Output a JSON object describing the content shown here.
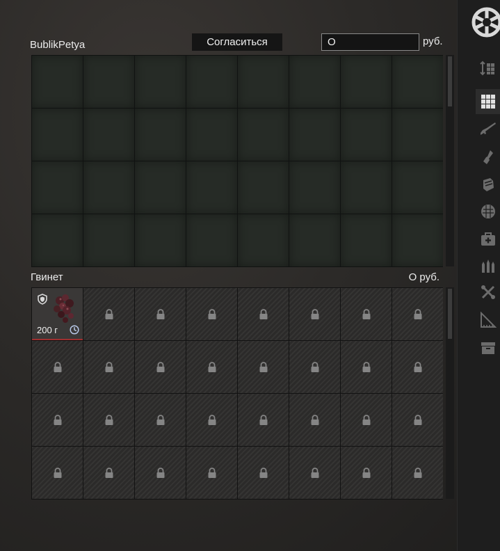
{
  "player": {
    "name": "BublikPetya"
  },
  "trade": {
    "accept_label": "Согласиться",
    "price_value": "О",
    "currency": "руб."
  },
  "trader": {
    "name": "Гвинет",
    "total": "О руб.",
    "item": {
      "weight": "200 г",
      "icon": "dried-berries-icon"
    }
  },
  "side_nav": [
    "sort-icon",
    "grid-all-icon",
    "rifle-icon",
    "gear-icon",
    "armor-icon",
    "container-icon",
    "medkit-icon",
    "ammo-icon",
    "tools-icon",
    "ruler-icon",
    "storage-icon"
  ],
  "colors": {
    "accent_border": "#a03030",
    "player_cell": "#262b26",
    "trader_cell": "#2e2d2c"
  }
}
